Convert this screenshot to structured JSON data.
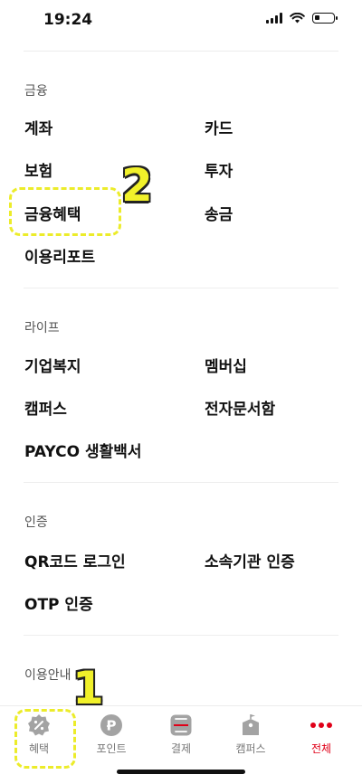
{
  "status_bar": {
    "time": "19:24"
  },
  "sections": [
    {
      "title": "금융",
      "items": [
        "계좌",
        "카드",
        "보험",
        "투자",
        "금융혜택",
        "송금",
        "이용리포트"
      ]
    },
    {
      "title": "라이프",
      "items": [
        "기업복지",
        "멤버십",
        "캠퍼스",
        "전자문서함",
        "PAYCO 생활백서"
      ]
    },
    {
      "title": "인증",
      "items": [
        "QR코드 로그인",
        "소속기관 인증",
        "OTP 인증"
      ]
    },
    {
      "title": "이용안내"
    }
  ],
  "annotations": {
    "first": "1",
    "second": "2"
  },
  "bottom_nav": [
    {
      "label": "혜택",
      "icon": "percent-badge-icon"
    },
    {
      "label": "포인트",
      "icon": "point-p-icon"
    },
    {
      "label": "결제",
      "icon": "scan-pay-icon"
    },
    {
      "label": "캠퍼스",
      "icon": "campus-building-icon"
    },
    {
      "label": "전체",
      "icon": "more-dots-icon",
      "active": true
    }
  ],
  "colors": {
    "accent_red": "#e00018",
    "annotation_yellow": "#f1f12a",
    "nav_gray": "#9a9a9a"
  }
}
